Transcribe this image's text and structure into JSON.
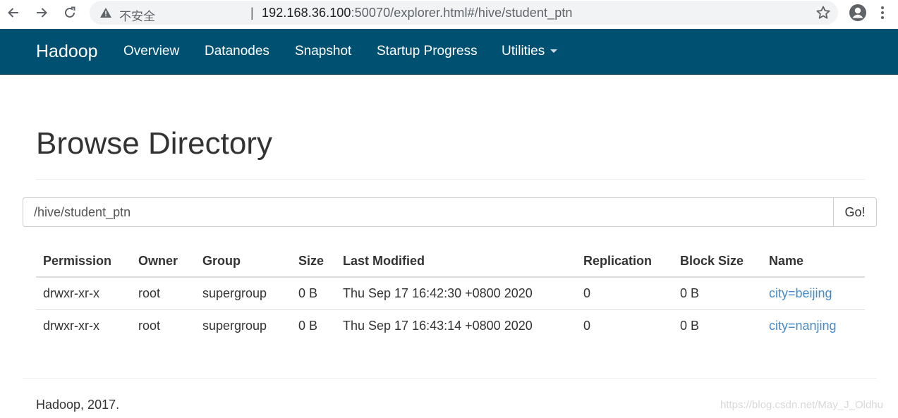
{
  "browser": {
    "security_label": "不安全",
    "separator": "|",
    "url_host": "192.168.36.100",
    "url_rest": ":50070/explorer.html#/hive/student_ptn"
  },
  "navbar": {
    "brand": "Hadoop",
    "items": [
      "Overview",
      "Datanodes",
      "Snapshot",
      "Startup Progress",
      "Utilities"
    ],
    "background": "#005072"
  },
  "page": {
    "title": "Browse Directory",
    "path_value": "/hive/student_ptn",
    "go_label": "Go!"
  },
  "table": {
    "headers": [
      "Permission",
      "Owner",
      "Group",
      "Size",
      "Last Modified",
      "Replication",
      "Block Size",
      "Name"
    ],
    "rows": [
      [
        "drwxr-xr-x",
        "root",
        "supergroup",
        "0 B",
        "Thu Sep 17 16:42:30 +0800 2020",
        "0",
        "0 B",
        "city=beijing"
      ],
      [
        "drwxr-xr-x",
        "root",
        "supergroup",
        "0 B",
        "Thu Sep 17 16:43:14 +0800 2020",
        "0",
        "0 B",
        "city=nanjing"
      ]
    ],
    "link_color": "#428bca"
  },
  "footer": {
    "text": "Hadoop, 2017.",
    "watermark": "https://blog.csdn.net/May_J_Oldhu"
  }
}
